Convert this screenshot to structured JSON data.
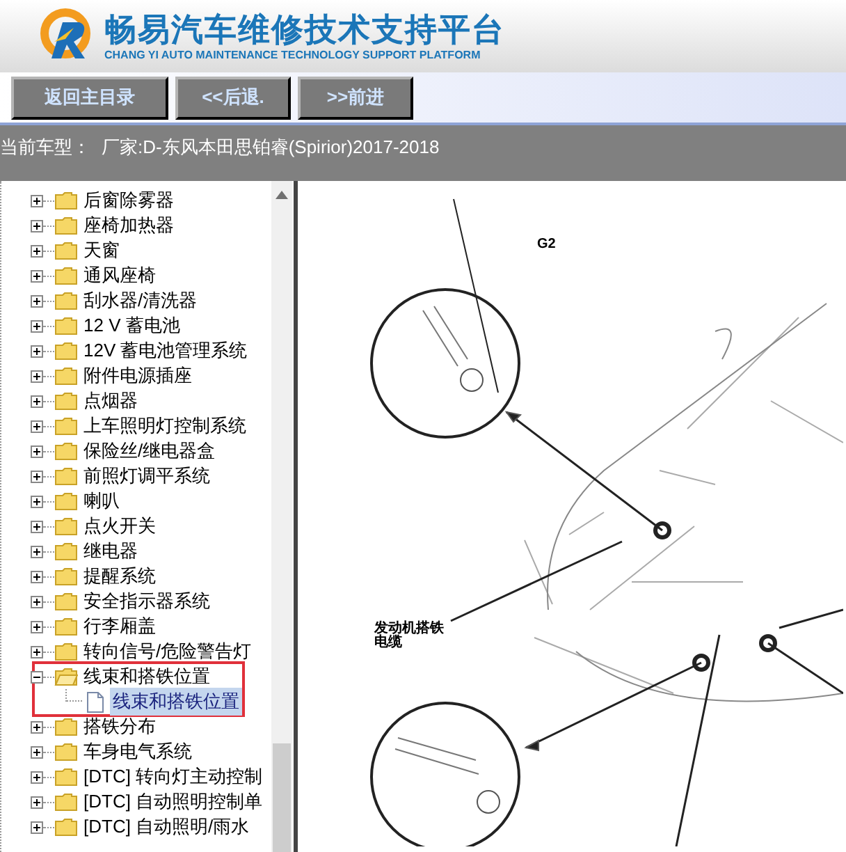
{
  "header": {
    "title": "畅易汽车维修技术支持平台",
    "subtitle": "CHANG YI AUTO MAINTENANCE TECHNOLOGY SUPPORT PLATFORM"
  },
  "nav_buttons": [
    "返回主目录",
    "<<后退.",
    ">>前进"
  ],
  "vehicle_bar": {
    "label": "当前车型：",
    "value": "厂家:D-东风本田思铂睿(Spirior)2017-2018"
  },
  "tree": [
    {
      "label": "后窗除雾器",
      "expanded": false
    },
    {
      "label": "座椅加热器",
      "expanded": false
    },
    {
      "label": "天窗",
      "expanded": false
    },
    {
      "label": "通风座椅",
      "expanded": false
    },
    {
      "label": "刮水器/清洗器",
      "expanded": false
    },
    {
      "label": "12 V 蓄电池",
      "expanded": false
    },
    {
      "label": "12V 蓄电池管理系统",
      "expanded": false
    },
    {
      "label": "附件电源插座",
      "expanded": false
    },
    {
      "label": "点烟器",
      "expanded": false
    },
    {
      "label": "上车照明灯控制系统",
      "expanded": false
    },
    {
      "label": "保险丝/继电器盒",
      "expanded": false
    },
    {
      "label": "前照灯调平系统",
      "expanded": false
    },
    {
      "label": "喇叭",
      "expanded": false
    },
    {
      "label": "点火开关",
      "expanded": false
    },
    {
      "label": "继电器",
      "expanded": false
    },
    {
      "label": "提醒系统",
      "expanded": false
    },
    {
      "label": "安全指示器系统",
      "expanded": false
    },
    {
      "label": "行李厢盖",
      "expanded": false
    },
    {
      "label": "转向信号/危险警告灯",
      "expanded": false
    },
    {
      "label": "线束和搭铁位置",
      "expanded": true,
      "highlighted": true,
      "children": [
        {
          "label": "线束和搭铁位置",
          "selected": true
        }
      ]
    },
    {
      "label": "搭铁分布",
      "expanded": false
    },
    {
      "label": "车身电气系统",
      "expanded": false
    },
    {
      "label": "[DTC] 转向灯主动控制",
      "expanded": false
    },
    {
      "label": "[DTC] 自动照明控制单",
      "expanded": false
    },
    {
      "label": "[DTC] 自动照明/雨水",
      "expanded": false
    }
  ],
  "diagram": {
    "callouts": [
      "G2",
      "发动机搭铁",
      "电缆"
    ]
  }
}
